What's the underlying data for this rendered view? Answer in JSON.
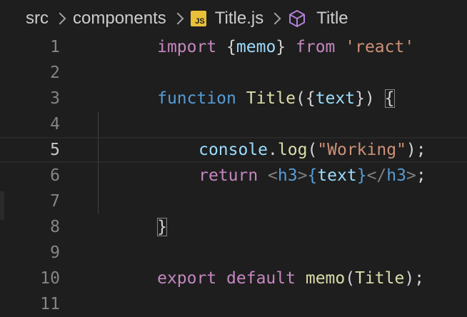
{
  "breadcrumb": {
    "parts": [
      "src",
      "components",
      "Title.js",
      "Title"
    ],
    "file_icon_label": "JS"
  },
  "editor": {
    "active_line": 5,
    "line_numbers": [
      "1",
      "2",
      "3",
      "4",
      "5",
      "6",
      "7",
      "8",
      "9",
      "10",
      "11"
    ],
    "lines": {
      "l1": {
        "kw": "import",
        "sp1": " ",
        "open": "{",
        "id": "memo",
        "close": "}",
        "sp2": " ",
        "from": "from",
        "sp3": " ",
        "str": "'react'"
      },
      "l3": {
        "kw": "function",
        "sp1": " ",
        "name": "Title",
        "open": "({",
        "param": "text",
        "close": "})",
        "sp2": " ",
        "brace": "{"
      },
      "l5": {
        "obj": "console",
        "dot": ".",
        "method": "log",
        "open": "(",
        "str": "\"Working\"",
        "close": ");"
      },
      "l6": {
        "kw": "return",
        "sp1": " ",
        "lt1": "<",
        "tag1": "h3",
        "gt1": ">",
        "ob": "{",
        "var": "text",
        "cb": "}",
        "lt2": "</",
        "tag2": "h3",
        "gt2": ">",
        "semi": ";"
      },
      "l8": {
        "brace": "}"
      },
      "l10": {
        "kw1": "export",
        "sp1": " ",
        "kw2": "default",
        "sp2": " ",
        "fn": "memo",
        "open": "(",
        "arg": "Title",
        "close": ");"
      }
    }
  },
  "colors": {
    "background": "#1e1e1e",
    "keyword_control": "#c586c0",
    "keyword": "#569cd6",
    "function": "#dcdcaa",
    "variable": "#9cdcfe",
    "string": "#ce9178",
    "js_icon": "#e8c03a",
    "symbol_icon": "#b180d7"
  }
}
